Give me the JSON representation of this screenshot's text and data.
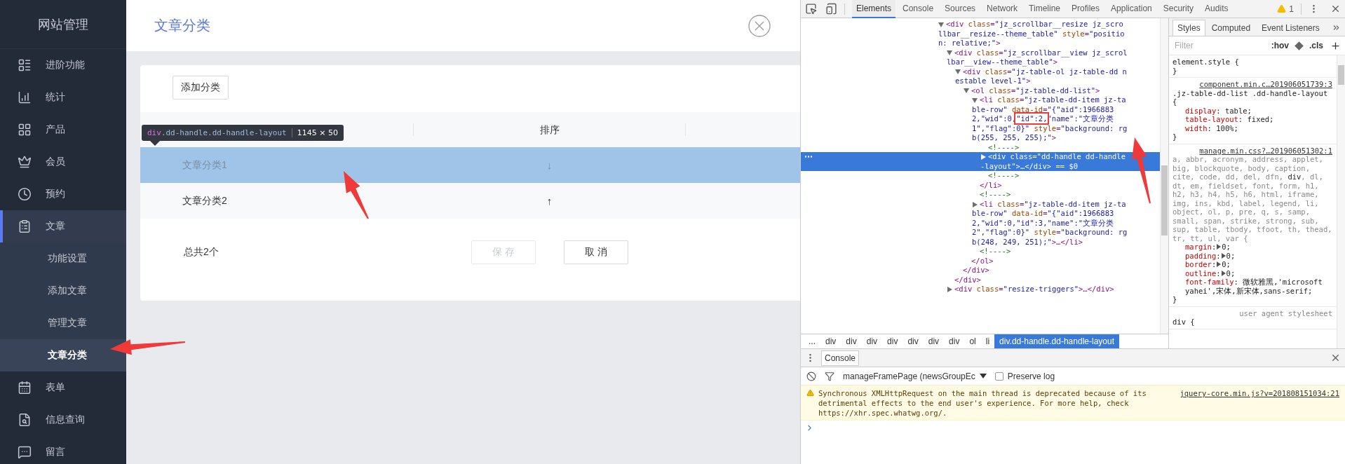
{
  "sidebar": {
    "title": "网站管理",
    "items": [
      {
        "label": "进阶功能",
        "selected": false
      },
      {
        "label": "统计",
        "selected": false
      },
      {
        "label": "产品",
        "selected": false
      },
      {
        "label": "会员",
        "selected": false
      },
      {
        "label": "预约",
        "selected": false
      },
      {
        "label": "文章",
        "selected": true,
        "expanded": true,
        "children": [
          {
            "label": "功能设置",
            "selected": false
          },
          {
            "label": "添加文章",
            "selected": false
          },
          {
            "label": "管理文章",
            "selected": false
          },
          {
            "label": "文章分类",
            "selected": true
          }
        ]
      },
      {
        "label": "表单",
        "selected": false
      },
      {
        "label": "信息查询",
        "selected": false
      },
      {
        "label": "留言",
        "selected": false
      }
    ]
  },
  "page": {
    "title": "文章分类",
    "add_button": "添加分类",
    "table": {
      "sort_header": "排序",
      "rows": [
        {
          "name": "文章分类1",
          "sort": "↓",
          "highlighted": true
        },
        {
          "name": "文章分类2",
          "sort": "↑",
          "highlighted": false
        }
      ]
    },
    "total": "总共2个",
    "save_button": {
      "label": "保 存",
      "disabled": true
    },
    "cancel_button": {
      "label": "取 消",
      "disabled": false
    }
  },
  "inspect_tooltip": {
    "tag": "div",
    "classes": ".dd-handle.dd-handle-layout",
    "size": "1145 × 50"
  },
  "devtools": {
    "tabs": [
      {
        "label": "Elements",
        "selected": true
      },
      {
        "label": "Console",
        "selected": false
      },
      {
        "label": "Sources",
        "selected": false
      },
      {
        "label": "Network",
        "selected": false
      },
      {
        "label": "Timeline",
        "selected": false
      },
      {
        "label": "Profiles",
        "selected": false
      },
      {
        "label": "Application",
        "selected": false
      },
      {
        "label": "Security",
        "selected": false
      },
      {
        "label": "Audits",
        "selected": false
      }
    ],
    "warning_count": "1",
    "dom_tree": [
      {
        "kind": "element",
        "expanded": true,
        "selected": false,
        "parts": [
          {
            "kind": "tag",
            "t": "<div"
          },
          {
            "kind": "attr",
            "t": " class"
          },
          {
            "kind": "tag",
            "t": "="
          },
          {
            "kind": "value",
            "t": "\"jz_scrollbar__resize jz_scrollbar__resize--theme_table\""
          },
          {
            "kind": "attr",
            "t": " style"
          },
          {
            "kind": "tag",
            "t": "="
          },
          {
            "kind": "value",
            "t": "\"position: relative;\""
          },
          {
            "kind": "tag",
            "t": ">"
          }
        ],
        "children": [
          {
            "kind": "element",
            "expanded": true,
            "selected": false,
            "parts": [
              {
                "kind": "tag",
                "t": "<div"
              },
              {
                "kind": "attr",
                "t": " class"
              },
              {
                "kind": "tag",
                "t": "="
              },
              {
                "kind": "value",
                "t": "\"jz_scrollbar__view jz_scrollbar__view--theme_table\""
              },
              {
                "kind": "tag",
                "t": ">"
              }
            ],
            "close": "</div>",
            "children": [
              {
                "kind": "element",
                "expanded": true,
                "selected": false,
                "parts": [
                  {
                    "kind": "tag",
                    "t": "<div"
                  },
                  {
                    "kind": "attr",
                    "t": " class"
                  },
                  {
                    "kind": "tag",
                    "t": "="
                  },
                  {
                    "kind": "value",
                    "t": "\"jz-table-ol jz-table-dd nestable level-1\""
                  },
                  {
                    "kind": "tag",
                    "t": ">"
                  }
                ],
                "close": "</div>",
                "children": [
                  {
                    "kind": "element",
                    "expanded": true,
                    "selected": false,
                    "parts": [
                      {
                        "kind": "tag",
                        "t": "<ol"
                      },
                      {
                        "kind": "attr",
                        "t": " class"
                      },
                      {
                        "kind": "tag",
                        "t": "="
                      },
                      {
                        "kind": "value",
                        "t": "\"jz-table-dd-list\""
                      },
                      {
                        "kind": "tag",
                        "t": ">"
                      }
                    ],
                    "close": "</ol>",
                    "children": [
                      {
                        "kind": "element",
                        "expanded": true,
                        "selected": false,
                        "parts": [
                          {
                            "kind": "tag",
                            "t": "<li"
                          },
                          {
                            "kind": "attr",
                            "t": " class"
                          },
                          {
                            "kind": "tag",
                            "t": "="
                          },
                          {
                            "kind": "value",
                            "t": "\"jz-table-dd-item jz-table-row\""
                          },
                          {
                            "kind": "attr",
                            "t": " data-id"
                          },
                          {
                            "kind": "tag",
                            "t": "="
                          },
                          {
                            "kind": "value",
                            "t": "\"{\"aid\":19668832,\"wid\":0,"
                          },
                          {
                            "kind": "value",
                            "t": "\"id\":2,",
                            "boxed": true
                          },
                          {
                            "kind": "value",
                            "t": "\"name\":\"文章分类1\",\"flag\":0}\""
                          },
                          {
                            "kind": "attr",
                            "t": " style"
                          },
                          {
                            "kind": "tag",
                            "t": "="
                          },
                          {
                            "kind": "value",
                            "t": "\"background: rgb(255, 255, 255);\""
                          },
                          {
                            "kind": "tag",
                            "t": ">"
                          }
                        ],
                        "close": "</li>",
                        "children": [
                          {
                            "kind": "comment",
                            "selected": false,
                            "parts": [
                              {
                                "kind": "comment",
                                "t": "<!---->"
                              }
                            ]
                          },
                          {
                            "kind": "element",
                            "expanded": false,
                            "selected": true,
                            "parts": [
                              {
                                "kind": "tag",
                                "t": "<div"
                              },
                              {
                                "kind": "attr",
                                "t": " class"
                              },
                              {
                                "kind": "tag",
                                "t": "="
                              },
                              {
                                "kind": "value",
                                "t": "\"dd-handle dd-handle-layout\""
                              },
                              {
                                "kind": "tag",
                                "t": ">…</div>"
                              },
                              {
                                "kind": "ref",
                                "t": " == $0"
                              }
                            ]
                          },
                          {
                            "kind": "comment",
                            "selected": false,
                            "parts": [
                              {
                                "kind": "comment",
                                "t": "<!---->"
                              }
                            ]
                          }
                        ]
                      },
                      {
                        "kind": "comment",
                        "selected": false,
                        "parts": [
                          {
                            "kind": "comment",
                            "t": "<!---->"
                          }
                        ]
                      },
                      {
                        "kind": "element",
                        "expanded": false,
                        "selected": false,
                        "parts": [
                          {
                            "kind": "tag",
                            "t": "<li"
                          },
                          {
                            "kind": "attr",
                            "t": " class"
                          },
                          {
                            "kind": "tag",
                            "t": "="
                          },
                          {
                            "kind": "value",
                            "t": "\"jz-table-dd-item jz-table-row\""
                          },
                          {
                            "kind": "attr",
                            "t": " data-id"
                          },
                          {
                            "kind": "tag",
                            "t": "="
                          },
                          {
                            "kind": "value",
                            "t": "\"{\"aid\":19668832,\"wid\":0,\"id\":3,\"name\":\"文章分类2\",\"flag\":0}\""
                          },
                          {
                            "kind": "attr",
                            "t": " style"
                          },
                          {
                            "kind": "tag",
                            "t": "="
                          },
                          {
                            "kind": "value",
                            "t": "\"background: rgb(248, 249, 251);\""
                          },
                          {
                            "kind": "tag",
                            "t": ">…</li>"
                          }
                        ]
                      },
                      {
                        "kind": "comment",
                        "selected": false,
                        "parts": [
                          {
                            "kind": "comment",
                            "t": "<!---->"
                          }
                        ]
                      }
                    ]
                  }
                ]
              }
            ]
          },
          {
            "kind": "element",
            "expanded": false,
            "selected": false,
            "parts": [
              {
                "kind": "tag",
                "t": "<div"
              },
              {
                "kind": "attr",
                "t": " class"
              },
              {
                "kind": "tag",
                "t": "="
              },
              {
                "kind": "value",
                "t": "\"resize-triggers\""
              },
              {
                "kind": "tag",
                "t": ">…</div>"
              }
            ]
          }
        ]
      }
    ],
    "breadcrumbs": [
      {
        "label": "...",
        "selected": false
      },
      {
        "label": "div",
        "selected": false
      },
      {
        "label": "div",
        "selected": false
      },
      {
        "label": "div",
        "selected": false
      },
      {
        "label": "div",
        "selected": false
      },
      {
        "label": "div",
        "selected": false
      },
      {
        "label": "div",
        "selected": false
      },
      {
        "label": "div",
        "selected": false
      },
      {
        "label": "ol",
        "selected": false
      },
      {
        "label": "li",
        "selected": false
      },
      {
        "label": "div.dd-handle.dd-handle-layout",
        "selected": true
      }
    ],
    "styles": {
      "tabs": [
        {
          "label": "Styles",
          "selected": true
        },
        {
          "label": "Computed",
          "selected": false
        },
        {
          "label": "Event Listeners",
          "selected": false
        }
      ],
      "filter_placeholder": "Filter",
      "hov": ":hov",
      "cls": ".cls",
      "rules": [
        {
          "selector": [
            {
              "t": "element.style {",
              "matched": true
            }
          ],
          "close": "}"
        },
        {
          "selector": [
            {
              "t": ".jz-table-dd-list .dd-handle-layout {",
              "matched": true
            }
          ],
          "source": "component.min.c…201906051739:3",
          "source_link": true,
          "properties": [
            {
              "name": "display",
              "sep": ": ",
              "value": "table;",
              "shorthand": false
            },
            {
              "name": "table-layout",
              "sep": ": ",
              "value": "fixed;",
              "shorthand": false
            },
            {
              "name": "width",
              "sep": ": ",
              "value": "100%;",
              "shorthand": false
            }
          ],
          "close": "}"
        },
        {
          "selector": [
            {
              "t": "a, abbr, acronym, address, applet, big, blockquote, body, caption, cite, code, dd, del, dfn, ",
              "matched": false
            },
            {
              "t": "div",
              "matched": true
            },
            {
              "t": ", dl, dt, em, fieldset, font, form, h1, h2, h3, h4, h5, h6, html, iframe, img, ins, kbd, label, legend, li, object, ol, p, pre, q, s, samp, small, span, strike, strong, sub, sup, table, tbody, tfoot, th, thead, tr, tt, ul, var {",
              "matched": false
            }
          ],
          "source": "manage.min.css?…201906051302:1",
          "source_link": true,
          "properties": [
            {
              "name": "margin",
              "sep": ":",
              "value": "0;",
              "shorthand": true
            },
            {
              "name": "padding",
              "sep": ":",
              "value": "0;",
              "shorthand": true
            },
            {
              "name": "border",
              "sep": ":",
              "value": "0;",
              "shorthand": true
            },
            {
              "name": "outline",
              "sep": ":",
              "value": "0;",
              "shorthand": true
            },
            {
              "name": "font-family",
              "sep": ": ",
              "value": "微软雅黑,'microsoft yahei',宋体,新宋体,sans-serif;",
              "shorthand": false
            }
          ],
          "close": "}"
        },
        {
          "selector": [
            {
              "t": "div {",
              "matched": true
            }
          ],
          "source": "user agent stylesheet",
          "source_link": false
        }
      ]
    },
    "console": {
      "tab": "Console",
      "context": "manageFramePage (newsGroupEc",
      "preserve_log": {
        "label": "Preserve log",
        "checked": false
      },
      "messages": [
        {
          "kind": "warning",
          "text": "Synchronous XMLHttpRequest on the main thread is deprecated because of its detrimental effects to the end user's experience. For more help, check https://xhr.spec.whatwg.org/.",
          "source": "jquery-core.min.js?v=201808151034:21"
        }
      ]
    }
  }
}
